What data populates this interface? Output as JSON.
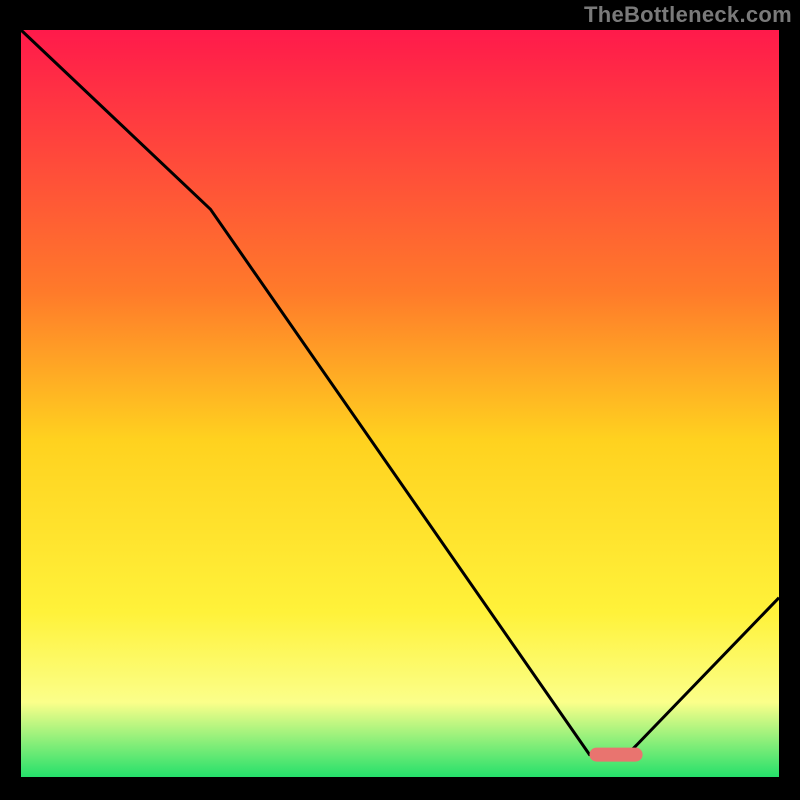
{
  "attribution": "TheBottleneck.com",
  "chart_data": {
    "type": "line",
    "title": "",
    "xlabel": "",
    "ylabel": "",
    "xlim": [
      0,
      100
    ],
    "ylim": [
      0,
      100
    ],
    "x": [
      0,
      25,
      75,
      80,
      100
    ],
    "values": [
      100,
      76,
      3,
      3,
      24
    ],
    "marker": {
      "x_start": 75,
      "x_end": 82,
      "y": 3
    },
    "gradient_stops": [
      {
        "offset": 0,
        "color": "#ff1a4b"
      },
      {
        "offset": 35,
        "color": "#ff7a2a"
      },
      {
        "offset": 55,
        "color": "#ffd21f"
      },
      {
        "offset": 78,
        "color": "#fff23a"
      },
      {
        "offset": 90,
        "color": "#fbff8a"
      },
      {
        "offset": 100,
        "color": "#25e06b"
      }
    ],
    "curve_color": "#000000",
    "marker_color": "#e9746f",
    "background": "#000000"
  }
}
